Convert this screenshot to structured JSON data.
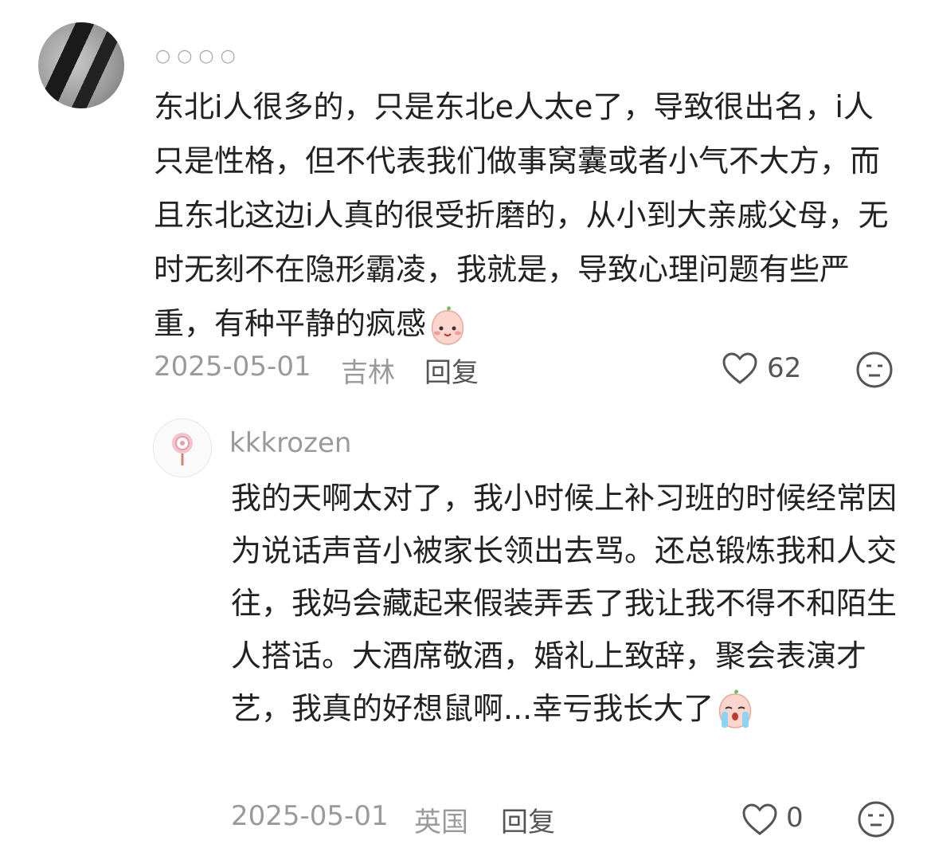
{
  "main_comment": {
    "username": "○○○○",
    "text": "东北i人很多的，只是东北e人太e了，导致很出名，i人只是性格，但不代表我们做事窝囊或者小气不大方，而且东北这边i人真的很受折磨的，从小到大亲戚父母，无时无刻不在隐形霸凌，我就是，导致心理问题有些严重，有种平静的疯感",
    "emoji": "smiling-peach-emoji",
    "date": "2025-05-01",
    "location": "吉林",
    "reply_label": "回复",
    "like_count": "62",
    "like_icon": "heart-outline-icon",
    "dislike_icon": "meh-face-icon"
  },
  "reply_comment": {
    "username": "kkkrozen",
    "text": "我的天啊太对了，我小时候上补习班的时候经常因为说话声音小被家长领出去骂。还总锻炼我和人交往，我妈会藏起来假装弄丢了我让我不得不和陌生人搭话。大酒席敬酒，婚礼上致辞，聚会表演才艺，我真的好想鼠啊...幸亏我长大了",
    "emoji": "crying-peach-emoji",
    "date": "2025-05-01",
    "location": "英国",
    "reply_label": "回复",
    "like_count": "0",
    "like_icon": "heart-outline-icon",
    "dislike_icon": "meh-face-icon"
  },
  "colors": {
    "text": "#222222",
    "meta": "#9a9a9a",
    "background": "#ffffff"
  }
}
